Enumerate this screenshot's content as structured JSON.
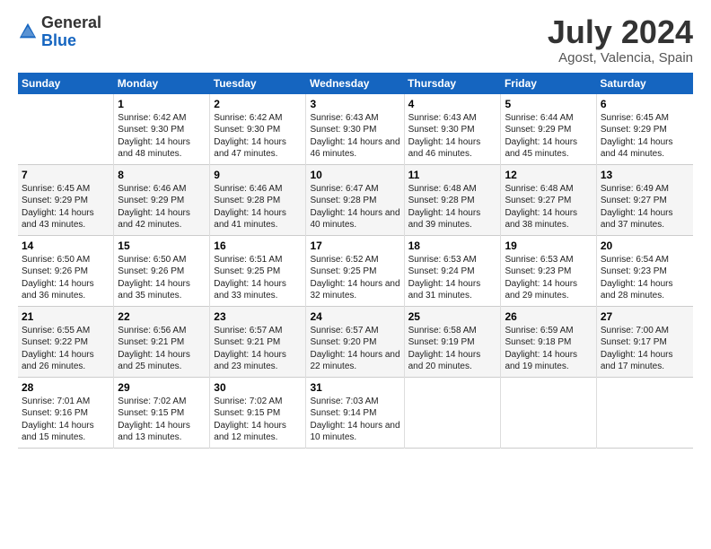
{
  "logo": {
    "general": "General",
    "blue": "Blue"
  },
  "title": {
    "month_year": "July 2024",
    "location": "Agost, Valencia, Spain"
  },
  "weekdays": [
    "Sunday",
    "Monday",
    "Tuesday",
    "Wednesday",
    "Thursday",
    "Friday",
    "Saturday"
  ],
  "weeks": [
    [
      {
        "day": "",
        "sunrise": "",
        "sunset": "",
        "daylight": ""
      },
      {
        "day": "1",
        "sunrise": "Sunrise: 6:42 AM",
        "sunset": "Sunset: 9:30 PM",
        "daylight": "Daylight: 14 hours and 48 minutes."
      },
      {
        "day": "2",
        "sunrise": "Sunrise: 6:42 AM",
        "sunset": "Sunset: 9:30 PM",
        "daylight": "Daylight: 14 hours and 47 minutes."
      },
      {
        "day": "3",
        "sunrise": "Sunrise: 6:43 AM",
        "sunset": "Sunset: 9:30 PM",
        "daylight": "Daylight: 14 hours and 46 minutes."
      },
      {
        "day": "4",
        "sunrise": "Sunrise: 6:43 AM",
        "sunset": "Sunset: 9:30 PM",
        "daylight": "Daylight: 14 hours and 46 minutes."
      },
      {
        "day": "5",
        "sunrise": "Sunrise: 6:44 AM",
        "sunset": "Sunset: 9:29 PM",
        "daylight": "Daylight: 14 hours and 45 minutes."
      },
      {
        "day": "6",
        "sunrise": "Sunrise: 6:45 AM",
        "sunset": "Sunset: 9:29 PM",
        "daylight": "Daylight: 14 hours and 44 minutes."
      }
    ],
    [
      {
        "day": "7",
        "sunrise": "Sunrise: 6:45 AM",
        "sunset": "Sunset: 9:29 PM",
        "daylight": "Daylight: 14 hours and 43 minutes."
      },
      {
        "day": "8",
        "sunrise": "Sunrise: 6:46 AM",
        "sunset": "Sunset: 9:29 PM",
        "daylight": "Daylight: 14 hours and 42 minutes."
      },
      {
        "day": "9",
        "sunrise": "Sunrise: 6:46 AM",
        "sunset": "Sunset: 9:28 PM",
        "daylight": "Daylight: 14 hours and 41 minutes."
      },
      {
        "day": "10",
        "sunrise": "Sunrise: 6:47 AM",
        "sunset": "Sunset: 9:28 PM",
        "daylight": "Daylight: 14 hours and 40 minutes."
      },
      {
        "day": "11",
        "sunrise": "Sunrise: 6:48 AM",
        "sunset": "Sunset: 9:28 PM",
        "daylight": "Daylight: 14 hours and 39 minutes."
      },
      {
        "day": "12",
        "sunrise": "Sunrise: 6:48 AM",
        "sunset": "Sunset: 9:27 PM",
        "daylight": "Daylight: 14 hours and 38 minutes."
      },
      {
        "day": "13",
        "sunrise": "Sunrise: 6:49 AM",
        "sunset": "Sunset: 9:27 PM",
        "daylight": "Daylight: 14 hours and 37 minutes."
      }
    ],
    [
      {
        "day": "14",
        "sunrise": "Sunrise: 6:50 AM",
        "sunset": "Sunset: 9:26 PM",
        "daylight": "Daylight: 14 hours and 36 minutes."
      },
      {
        "day": "15",
        "sunrise": "Sunrise: 6:50 AM",
        "sunset": "Sunset: 9:26 PM",
        "daylight": "Daylight: 14 hours and 35 minutes."
      },
      {
        "day": "16",
        "sunrise": "Sunrise: 6:51 AM",
        "sunset": "Sunset: 9:25 PM",
        "daylight": "Daylight: 14 hours and 33 minutes."
      },
      {
        "day": "17",
        "sunrise": "Sunrise: 6:52 AM",
        "sunset": "Sunset: 9:25 PM",
        "daylight": "Daylight: 14 hours and 32 minutes."
      },
      {
        "day": "18",
        "sunrise": "Sunrise: 6:53 AM",
        "sunset": "Sunset: 9:24 PM",
        "daylight": "Daylight: 14 hours and 31 minutes."
      },
      {
        "day": "19",
        "sunrise": "Sunrise: 6:53 AM",
        "sunset": "Sunset: 9:23 PM",
        "daylight": "Daylight: 14 hours and 29 minutes."
      },
      {
        "day": "20",
        "sunrise": "Sunrise: 6:54 AM",
        "sunset": "Sunset: 9:23 PM",
        "daylight": "Daylight: 14 hours and 28 minutes."
      }
    ],
    [
      {
        "day": "21",
        "sunrise": "Sunrise: 6:55 AM",
        "sunset": "Sunset: 9:22 PM",
        "daylight": "Daylight: 14 hours and 26 minutes."
      },
      {
        "day": "22",
        "sunrise": "Sunrise: 6:56 AM",
        "sunset": "Sunset: 9:21 PM",
        "daylight": "Daylight: 14 hours and 25 minutes."
      },
      {
        "day": "23",
        "sunrise": "Sunrise: 6:57 AM",
        "sunset": "Sunset: 9:21 PM",
        "daylight": "Daylight: 14 hours and 23 minutes."
      },
      {
        "day": "24",
        "sunrise": "Sunrise: 6:57 AM",
        "sunset": "Sunset: 9:20 PM",
        "daylight": "Daylight: 14 hours and 22 minutes."
      },
      {
        "day": "25",
        "sunrise": "Sunrise: 6:58 AM",
        "sunset": "Sunset: 9:19 PM",
        "daylight": "Daylight: 14 hours and 20 minutes."
      },
      {
        "day": "26",
        "sunrise": "Sunrise: 6:59 AM",
        "sunset": "Sunset: 9:18 PM",
        "daylight": "Daylight: 14 hours and 19 minutes."
      },
      {
        "day": "27",
        "sunrise": "Sunrise: 7:00 AM",
        "sunset": "Sunset: 9:17 PM",
        "daylight": "Daylight: 14 hours and 17 minutes."
      }
    ],
    [
      {
        "day": "28",
        "sunrise": "Sunrise: 7:01 AM",
        "sunset": "Sunset: 9:16 PM",
        "daylight": "Daylight: 14 hours and 15 minutes."
      },
      {
        "day": "29",
        "sunrise": "Sunrise: 7:02 AM",
        "sunset": "Sunset: 9:15 PM",
        "daylight": "Daylight: 14 hours and 13 minutes."
      },
      {
        "day": "30",
        "sunrise": "Sunrise: 7:02 AM",
        "sunset": "Sunset: 9:15 PM",
        "daylight": "Daylight: 14 hours and 12 minutes."
      },
      {
        "day": "31",
        "sunrise": "Sunrise: 7:03 AM",
        "sunset": "Sunset: 9:14 PM",
        "daylight": "Daylight: 14 hours and 10 minutes."
      },
      {
        "day": "",
        "sunrise": "",
        "sunset": "",
        "daylight": ""
      },
      {
        "day": "",
        "sunrise": "",
        "sunset": "",
        "daylight": ""
      },
      {
        "day": "",
        "sunrise": "",
        "sunset": "",
        "daylight": ""
      }
    ]
  ]
}
